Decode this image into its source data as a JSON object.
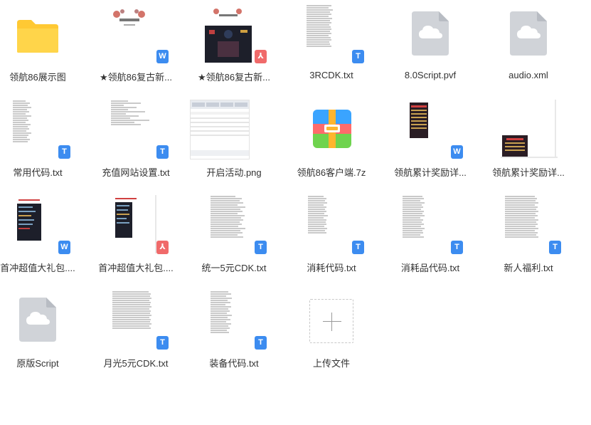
{
  "files": [
    {
      "label": "领航86展示图",
      "icon": "folder-icon"
    },
    {
      "label": "★领航86复古新...",
      "icon": "word-doc-icon"
    },
    {
      "label": "★领航86复古新...",
      "icon": "pdf-doc-icon"
    },
    {
      "label": "3RCDK.txt",
      "icon": "txt-file-icon"
    },
    {
      "label": "8.0Script.pvf",
      "icon": "cloud-file-icon"
    },
    {
      "label": "audio.xml",
      "icon": "cloud-file-icon"
    },
    {
      "label": "常用代码.txt",
      "icon": "txt-file-icon"
    },
    {
      "label": "充值网站设置.txt",
      "icon": "txt-file-icon"
    },
    {
      "label": "开启活动.png",
      "icon": "image-file-icon"
    },
    {
      "label": "领航86客户端.7z",
      "icon": "archive-icon"
    },
    {
      "label": "领航累计奖励详...",
      "icon": "word-doc-icon"
    },
    {
      "label": "领航累计奖励详...",
      "icon": "image-file-icon"
    },
    {
      "label": "首冲超值大礼包....",
      "icon": "word-doc-icon"
    },
    {
      "label": "首冲超值大礼包....",
      "icon": "pdf-doc-icon"
    },
    {
      "label": "统一5元CDK.txt",
      "icon": "txt-file-icon"
    },
    {
      "label": "消耗代码.txt",
      "icon": "txt-file-icon"
    },
    {
      "label": "消耗品代码.txt",
      "icon": "txt-file-icon"
    },
    {
      "label": "新人福利.txt",
      "icon": "txt-file-icon"
    },
    {
      "label": "原版Script",
      "icon": "cloud-file-icon"
    },
    {
      "label": "月光5元CDK.txt",
      "icon": "txt-file-icon"
    },
    {
      "label": "装备代码.txt",
      "icon": "txt-file-icon"
    },
    {
      "label": "上传文件",
      "icon": "plus-icon"
    }
  ],
  "badges": {
    "txt": "T",
    "word": "W",
    "pdf": "⅄"
  },
  "colors": {
    "folder": "#ffc933",
    "txt_badge": "#3c8cf0",
    "pdf_badge": "#f06a6a",
    "cloud_file": "#d0d3d8"
  }
}
